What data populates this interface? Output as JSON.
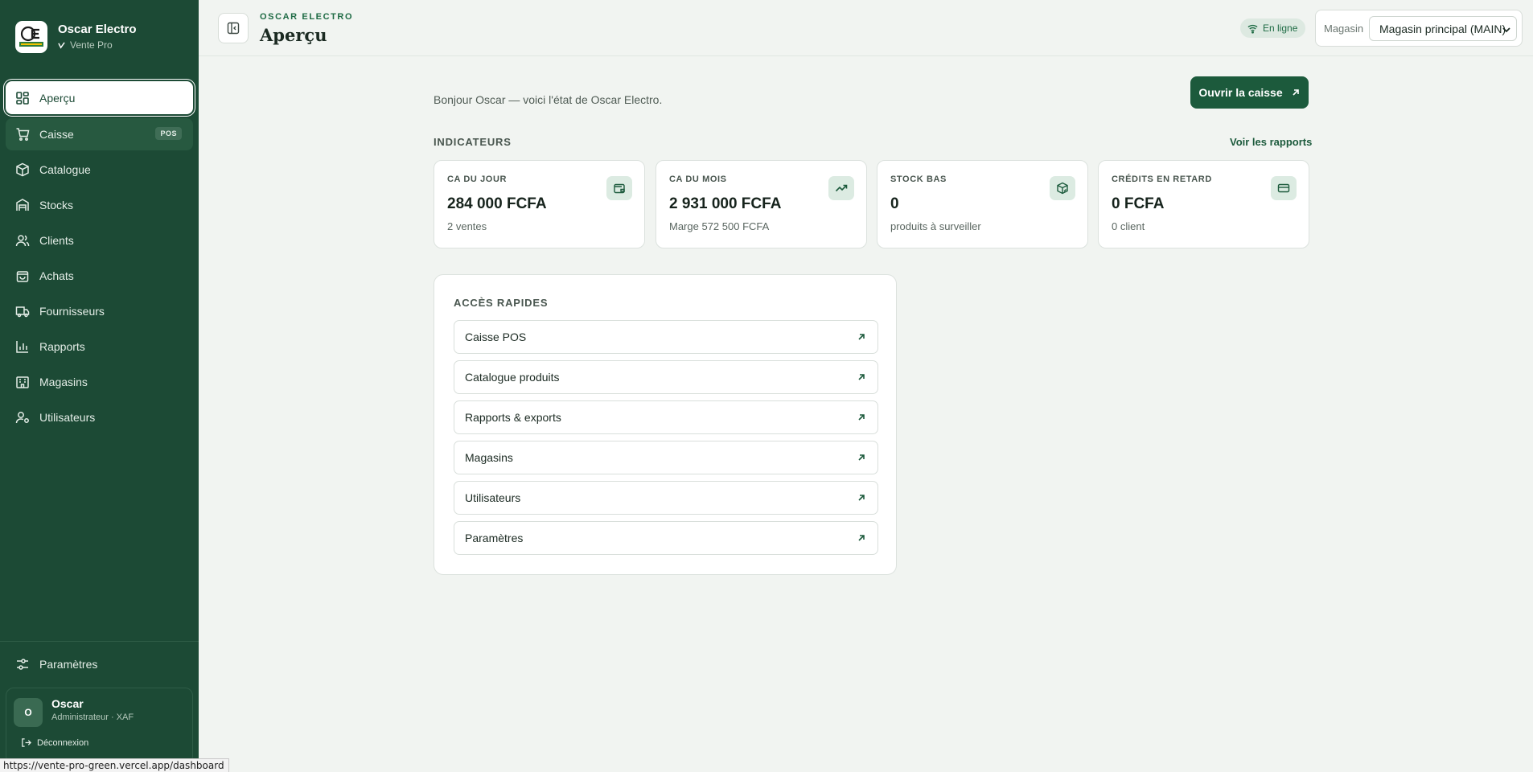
{
  "brand": {
    "name": "Oscar Electro",
    "sub": "Vente Pro"
  },
  "nav": [
    {
      "label": "Aperçu"
    },
    {
      "label": "Caisse",
      "badge": "POS"
    },
    {
      "label": "Catalogue"
    },
    {
      "label": "Stocks"
    },
    {
      "label": "Clients"
    },
    {
      "label": "Achats"
    },
    {
      "label": "Fournisseurs"
    },
    {
      "label": "Rapports"
    },
    {
      "label": "Magasins"
    },
    {
      "label": "Utilisateurs"
    }
  ],
  "settings": {
    "label": "Paramètres"
  },
  "user": {
    "initial": "O",
    "name": "Oscar",
    "role": "Administrateur · XAF",
    "logout": "Déconnexion"
  },
  "status_url": "https://vente-pro-green.vercel.app/dashboard",
  "header": {
    "eyebrow": "OSCAR ELECTRO",
    "title": "Aperçu",
    "online": "En ligne",
    "store_label": "Magasin",
    "store_value": "Magasin principal (MAIN)"
  },
  "main": {
    "greeting": "Bonjour Oscar — voici l'état de Oscar Electro.",
    "cta": "Ouvrir la caisse",
    "indicators_title": "INDICATEURS",
    "reports_link": "Voir les rapports",
    "kpis": [
      {
        "label": "CA DU JOUR",
        "value": "284 000 FCFA",
        "sub": "2 ventes",
        "icon": "wallet-icon"
      },
      {
        "label": "CA DU MOIS",
        "value": "2 931 000 FCFA",
        "sub": "Marge 572 500 FCFA",
        "icon": "trending-up-icon"
      },
      {
        "label": "STOCK BAS",
        "value": "0",
        "sub": "produits à surveiller",
        "icon": "package-icon"
      },
      {
        "label": "CRÉDITS EN RETARD",
        "value": "0 FCFA",
        "sub": "0 client",
        "icon": "credit-card-icon"
      }
    ],
    "quick_title": "ACCÈS RAPIDES",
    "quick_links": [
      {
        "label": "Caisse POS"
      },
      {
        "label": "Catalogue produits"
      },
      {
        "label": "Rapports & exports"
      },
      {
        "label": "Magasins"
      },
      {
        "label": "Utilisateurs"
      },
      {
        "label": "Paramètres"
      }
    ]
  },
  "colors": {
    "sidebar": "#1c4a35",
    "accent": "#1c5a3c",
    "background": "#f1f4f1"
  }
}
